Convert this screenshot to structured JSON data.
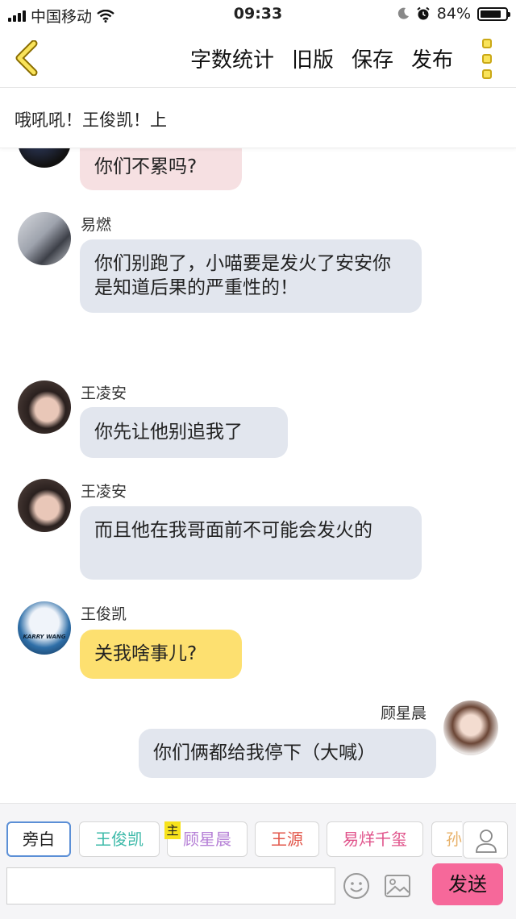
{
  "status": {
    "carrier": "中国移动",
    "time": "09:33",
    "battery": "84%",
    "battery_level": 0.84
  },
  "nav": {
    "word_count": "字数统计",
    "old_version": "旧版",
    "save": "保存",
    "publish": "发布"
  },
  "story_title": "哦吼吼！王俊凯！上",
  "messages": [
    {
      "name": "",
      "text": "你们不累吗?",
      "bubble": "pink",
      "side": "left"
    },
    {
      "name": "易燃",
      "text": "你们别跑了，小喵要是发火了安安你是知道后果的严重性的！",
      "bubble": "gray",
      "side": "left"
    },
    {
      "name": "王凌安",
      "text": "你先让他别追我了",
      "bubble": "gray",
      "side": "left"
    },
    {
      "name": "王凌安",
      "text": "而且他在我哥面前不可能会发火的",
      "bubble": "gray",
      "side": "left"
    },
    {
      "name": "王俊凯",
      "text": "关我啥事儿?",
      "bubble": "yellow",
      "side": "left"
    },
    {
      "name": "顾星晨",
      "text": "你们俩都给我停下（大喊）",
      "bubble": "gray",
      "side": "right"
    }
  ],
  "avatar_caption": "KARRY WANG",
  "roles": [
    {
      "label": "旁白",
      "color": "#222222",
      "selected": true
    },
    {
      "label": "王俊凯",
      "color": "#3bb9a8"
    },
    {
      "label": "顾星晨",
      "color": "#b57fd6"
    },
    {
      "label": "王源",
      "color": "#e2564a"
    },
    {
      "label": "易烊千玺",
      "color": "#e0528a"
    },
    {
      "label": "孙",
      "color": "#e8b26a"
    }
  ],
  "main_badge": "主",
  "input": {
    "value": "",
    "placeholder": ""
  },
  "send_label": "发送",
  "icons": [
    "back-icon",
    "more-icon",
    "emoji-icon",
    "image-icon",
    "person-icon"
  ]
}
